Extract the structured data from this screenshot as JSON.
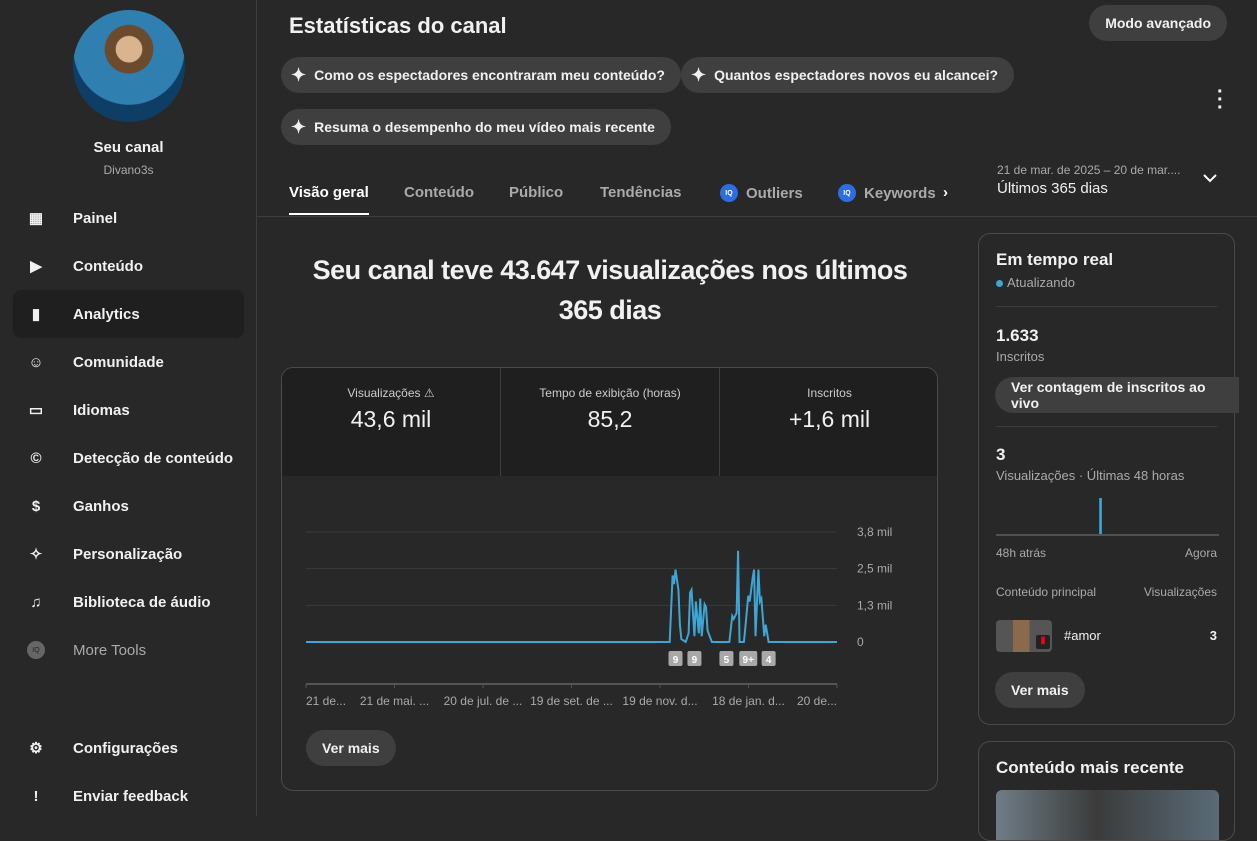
{
  "sidebar": {
    "channel_name": "Seu canal",
    "channel_handle": "Divano3s",
    "items": [
      {
        "label": "Painel",
        "icon": "dashboard-icon"
      },
      {
        "label": "Conteúdo",
        "icon": "content-icon"
      },
      {
        "label": "Analytics",
        "icon": "analytics-icon"
      },
      {
        "label": "Comunidade",
        "icon": "community-icon"
      },
      {
        "label": "Idiomas",
        "icon": "subtitles-icon"
      },
      {
        "label": "Detecção de conteúdo",
        "icon": "copyright-icon"
      },
      {
        "label": "Ganhos",
        "icon": "dollar-icon"
      },
      {
        "label": "Personalização",
        "icon": "magic-wand-icon"
      },
      {
        "label": "Biblioteca de áudio",
        "icon": "audio-library-icon"
      },
      {
        "label": "More Tools",
        "icon": "vidiq-icon"
      }
    ],
    "bottom": [
      {
        "label": "Configurações",
        "icon": "gear-icon"
      },
      {
        "label": "Enviar feedback",
        "icon": "feedback-icon"
      }
    ]
  },
  "header": {
    "title": "Estatísticas do canal",
    "advanced": "Modo avançado",
    "chips": [
      "Como os espectadores encontraram meu conteúdo?",
      "Quantos espectadores novos eu alcancei?",
      "Resuma o desempenho do meu vídeo mais recente"
    ]
  },
  "tabs": [
    "Visão geral",
    "Conteúdo",
    "Público",
    "Tendências",
    "Outliers",
    "Keywords"
  ],
  "date_range": {
    "dates": "21 de mar. de 2025 – 20 de mar....",
    "label": "Últimos 365 dias"
  },
  "headline": "Seu canal teve 43.647 visualizações nos últimos 365 dias",
  "metrics": [
    {
      "label": "Visualizações",
      "value": "43,6 mil"
    },
    {
      "label": "Tempo de exibição (horas)",
      "value": "85,2"
    },
    {
      "label": "Inscritos",
      "value": "+1,6 mil"
    }
  ],
  "ver_mais": "Ver mais",
  "chart_data": {
    "type": "line",
    "title": "Visualizações",
    "ylim": [
      0,
      3800
    ],
    "yticks": [
      {
        "v": 0,
        "label": "0"
      },
      {
        "v": 1266,
        "label": "1,3 mil"
      },
      {
        "v": 2533,
        "label": "2,5 mil"
      },
      {
        "v": 3800,
        "label": "3,8 mil"
      }
    ],
    "xlim": [
      0,
      365
    ],
    "xticks": [
      "21 de...",
      "21 de mai. ...",
      "20 de jul. de ...",
      "19 de set. de ...",
      "19 de nov. d...",
      "18 de jan. d...",
      "20 de..."
    ],
    "points": [
      [
        0,
        0
      ],
      [
        250,
        0
      ],
      [
        252,
        2300
      ],
      [
        253,
        2000
      ],
      [
        254,
        2500
      ],
      [
        256,
        1800
      ],
      [
        257,
        600
      ],
      [
        258,
        100
      ],
      [
        261,
        0
      ],
      [
        263,
        300
      ],
      [
        264,
        1700
      ],
      [
        265,
        1800
      ],
      [
        267,
        200
      ],
      [
        268,
        1400
      ],
      [
        270,
        300
      ],
      [
        271,
        1500
      ],
      [
        272,
        200
      ],
      [
        274,
        1300
      ],
      [
        275,
        1200
      ],
      [
        276,
        400
      ],
      [
        279,
        0
      ],
      [
        291,
        0
      ],
      [
        293,
        900
      ],
      [
        294,
        800
      ],
      [
        296,
        1000
      ],
      [
        297,
        3150
      ],
      [
        298,
        0
      ],
      [
        301,
        0
      ],
      [
        302,
        500
      ],
      [
        304,
        1600
      ],
      [
        305,
        1400
      ],
      [
        307,
        2200
      ],
      [
        308,
        2500
      ],
      [
        309,
        200
      ],
      [
        311,
        2500
      ],
      [
        312,
        1400
      ],
      [
        313,
        1500
      ],
      [
        315,
        200
      ],
      [
        316,
        600
      ],
      [
        318,
        0
      ],
      [
        365,
        0
      ]
    ],
    "markers": [
      {
        "x": 254,
        "label": "9"
      },
      {
        "x": 267,
        "label": "9"
      },
      {
        "x": 289,
        "label": "5"
      },
      {
        "x": 304,
        "label": "9+"
      },
      {
        "x": 318,
        "label": "4"
      }
    ],
    "color": "#3ea6d4"
  },
  "realtime": {
    "title": "Em tempo real",
    "status": "Atualizando",
    "subs": "1.633",
    "subs_label": "Inscritos",
    "live_button": "Ver contagem de inscritos ao vivo",
    "views": "3",
    "views_label": "Visualizações · Últimas 48 horas",
    "left": "48h atrás",
    "right": "Agora",
    "col1": "Conteúdo principal",
    "col2": "Visualizações",
    "top_title": "#amor",
    "top_views": "3",
    "more": "Ver mais",
    "bars": [
      0,
      0,
      0,
      0,
      0,
      0,
      0,
      0,
      0,
      0,
      0,
      0,
      0,
      0,
      0,
      0,
      0,
      0,
      0,
      0,
      0,
      0,
      3,
      0,
      0,
      0,
      0,
      0,
      0,
      0,
      0,
      0,
      0,
      0,
      0,
      0,
      0,
      0,
      0,
      0,
      0,
      0,
      0,
      0,
      0,
      0,
      0,
      0
    ]
  },
  "recent": {
    "title": "Conteúdo mais recente"
  }
}
